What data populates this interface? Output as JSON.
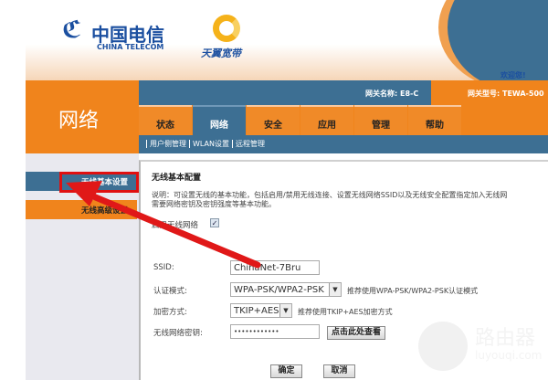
{
  "header": {
    "logo_cn": "中国电信",
    "logo_en": "CHINA TELECOM",
    "logo_mark": "ℭ",
    "brand2": "天翼宽带",
    "welcome": "欢迎您!"
  },
  "section_title": "网络",
  "info": {
    "gateway_name": "网关名称: E8-C",
    "gateway_model": "网关型号: TEWA-500"
  },
  "tabs": [
    "状态",
    "网络",
    "安全",
    "应用",
    "管理",
    "帮助"
  ],
  "subnav": [
    "用户侧管理",
    "WLAN设置",
    "远程管理"
  ],
  "sidebar": [
    "无线基本设置",
    "无线高级设置"
  ],
  "content": {
    "title": "无线基本配置",
    "desc1": "说明：可设置无线的基本功能，包括启用/禁用无线连接、设置无线网络SSID以及无线安全配置指定加入无线网",
    "desc2": "需要网络密钥及密钥强度等基本功能。",
    "enable_label": "启用无线网络",
    "ssid_label": "SSID:",
    "ssid_value": "ChinaNet-7Bru",
    "auth_label": "认证模式:",
    "auth_value": "WPA-PSK/WPA2-PSK",
    "auth_hint": "推荐使用WPA-PSK/WPA2-PSK认证模式",
    "enc_label": "加密方式:",
    "enc_value": "TKIP+AES",
    "enc_hint": "推荐使用TKIP+AES加密方式",
    "key_label": "无线网络密钥:",
    "key_value": "••••••••••••",
    "show_key": "点击此处查看",
    "ok": "确定",
    "cancel": "取消"
  },
  "watermark": {
    "cn": "路由器",
    "en": "luyouqi.com"
  }
}
